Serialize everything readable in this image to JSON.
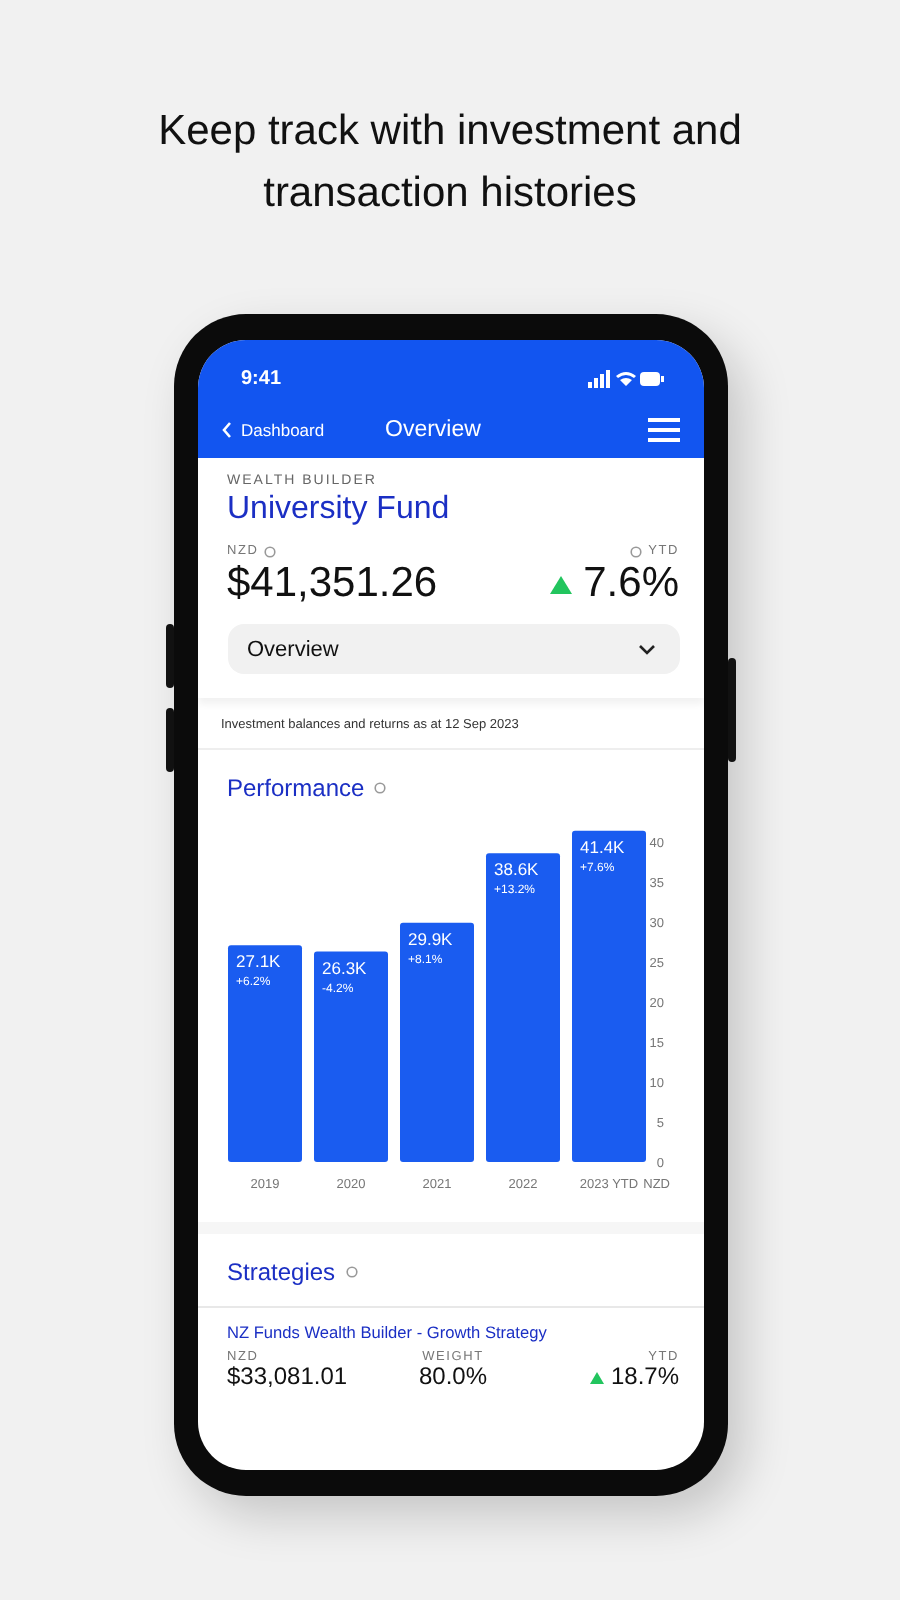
{
  "headline": "Keep track with investment and transaction histories",
  "status_bar": {
    "time": "9:41"
  },
  "nav": {
    "back": "Dashboard",
    "title": "Overview"
  },
  "account": {
    "category": "WEALTH BUILDER",
    "name": "University Fund",
    "currency": "NZD",
    "balance": "$41,351.26",
    "return_label": "YTD",
    "return_value": "7.6%",
    "trend_up": true
  },
  "view_select": {
    "value": "Overview"
  },
  "note": "Investment balances and returns as at 12 Sep 2023",
  "performance": {
    "title": "Performance",
    "bar_changes": [
      "+6.2%",
      "-4.2%",
      "+8.1%",
      "+13.2%",
      "+7.6%"
    ],
    "chart_data": {
      "type": "bar",
      "categories": [
        "2019",
        "2020",
        "2021",
        "2022",
        "2023 YTD"
      ],
      "values": [
        27.1,
        26.3,
        29.9,
        38.6,
        41.4
      ],
      "ylabel": "NZD",
      "yticks": [
        0,
        5,
        10,
        15,
        20,
        25,
        30,
        35,
        40
      ],
      "ylim": [
        0,
        42
      ],
      "value_labels": [
        "27.1K",
        "26.3K",
        "29.9K",
        "38.6K",
        "41.4K"
      ]
    }
  },
  "strategies": {
    "title": "Strategies",
    "items": [
      {
        "name": "NZ Funds Wealth Builder - Growth Strategy",
        "currency": "NZD",
        "value": "$33,081.01",
        "weight_label": "WEIGHT",
        "weight": "80.0%",
        "return_label": "YTD",
        "return_value": "18.7%",
        "trend_up": true
      }
    ]
  }
}
